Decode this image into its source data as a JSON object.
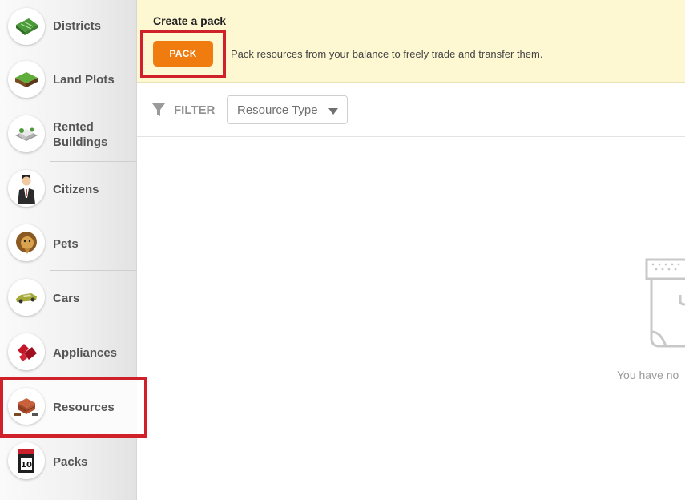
{
  "sidebar": {
    "items": [
      {
        "label": "Districts",
        "icon": "district-map-icon"
      },
      {
        "label": "Land Plots",
        "icon": "land-plot-icon"
      },
      {
        "label": "Rented\nBuildings",
        "icon": "building-icon"
      },
      {
        "label": "Citizens",
        "icon": "citizen-icon"
      },
      {
        "label": "Pets",
        "icon": "lion-icon"
      },
      {
        "label": "Cars",
        "icon": "car-icon"
      },
      {
        "label": "Appliances",
        "icon": "appliance-icon"
      },
      {
        "label": "Resources",
        "icon": "bricks-icon"
      },
      {
        "label": "Packs",
        "icon": "pack-icon"
      }
    ],
    "active_item": "Resources"
  },
  "pack_banner": {
    "title": "Create a pack",
    "button_label": "PACK",
    "description": "Pack resources from your balance to freely trade and transfer them."
  },
  "filter": {
    "label": "FILTER",
    "resource_type": "Resource Type"
  },
  "empty_state": {
    "text": "You have no"
  },
  "colors": {
    "accent_orange": "#f07b0f",
    "highlight_red": "#d0202a",
    "banner_bg": "#fdf8d2"
  }
}
